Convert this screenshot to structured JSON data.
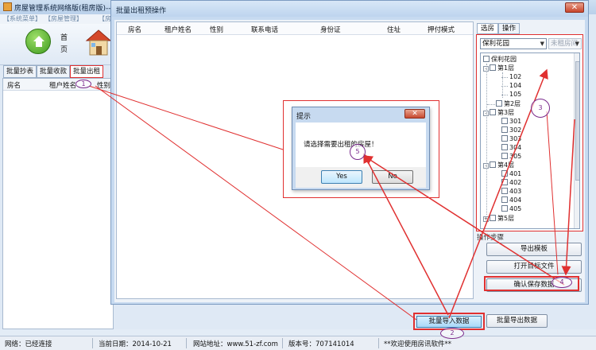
{
  "main_window": {
    "title": "房屋管理系统网络版(租房版)--lan",
    "menu": [
      "【系统菜单】",
      "【房屋管理】",
      "【房"
    ],
    "ribbon": {
      "home_label": "首页"
    },
    "tabs": [
      {
        "label": "批量抄表"
      },
      {
        "label": "批量收款"
      },
      {
        "label": "批量出租"
      }
    ],
    "grid_headers": [
      "房名",
      "租户姓名",
      "性别"
    ]
  },
  "dialog": {
    "title": "批量出租预操作",
    "close_glyph": "✕",
    "grid_headers": [
      "房名",
      "租户姓名",
      "性别",
      "联系电话",
      "身份证",
      "住址",
      "押付模式"
    ],
    "right_tabs": [
      {
        "label": "选房"
      },
      {
        "label": "操作"
      }
    ],
    "estate_combo": "保利花园",
    "room_type_combo": "未租房间",
    "tree": {
      "root": "保利花园",
      "floors": [
        {
          "label": "第1层",
          "rooms": [
            "102",
            "104",
            "105"
          ]
        },
        {
          "label": "第2层",
          "rooms": []
        },
        {
          "label": "第3层",
          "rooms": [
            "301",
            "302",
            "303",
            "304",
            "305"
          ]
        },
        {
          "label": "第4层",
          "rooms": [
            "401",
            "402",
            "403",
            "404",
            "405"
          ]
        },
        {
          "label": "第5层",
          "rooms": []
        }
      ]
    },
    "steps_label": "操作步骤",
    "buttons": {
      "export_template": "导出模板",
      "open_target": "打开目标文件",
      "confirm_save": "确认保存数据"
    }
  },
  "main_buttons": {
    "batch_import": "批量导入数据",
    "batch_export": "批量导出数据"
  },
  "prompt": {
    "title": "提示",
    "message": "请选择需要出租的房屋！",
    "yes": "Yes",
    "no": "No",
    "close_glyph": "✕"
  },
  "status": {
    "network": "网络：已经连接",
    "date": "当前日期：2014-10-21",
    "website": "网站地址：www.51-zf.com",
    "version": "版本号：707141014",
    "welcome": "**欢迎使用房讯软件**"
  },
  "callouts": [
    "1",
    "2",
    "3",
    "4",
    "5"
  ],
  "colors": {
    "highlight": "#e03030",
    "callout": "#7a2a8c",
    "window": "#c7daf0"
  }
}
